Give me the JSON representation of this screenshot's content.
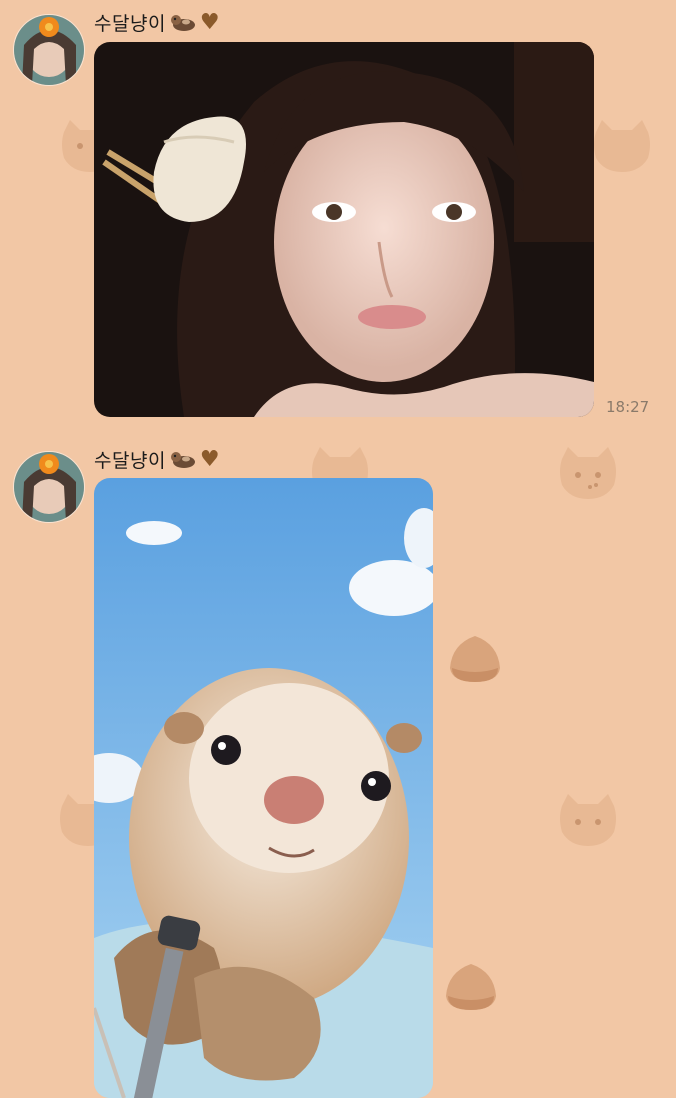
{
  "messages": [
    {
      "sender": "수달냥이",
      "heart": "♥",
      "photo": "selfie-photo",
      "time": "18:27"
    },
    {
      "sender": "수달냥이",
      "heart": "♥",
      "photo": "otter-selfie-photo",
      "time": ""
    }
  ],
  "colors": {
    "background": "#f2c7a5",
    "heart": "#8b5a2b",
    "time": "#8a7a6a"
  },
  "icons": [
    "otter-emoji-icon",
    "heart-icon",
    "cat-face-icon",
    "chestnut-icon"
  ]
}
